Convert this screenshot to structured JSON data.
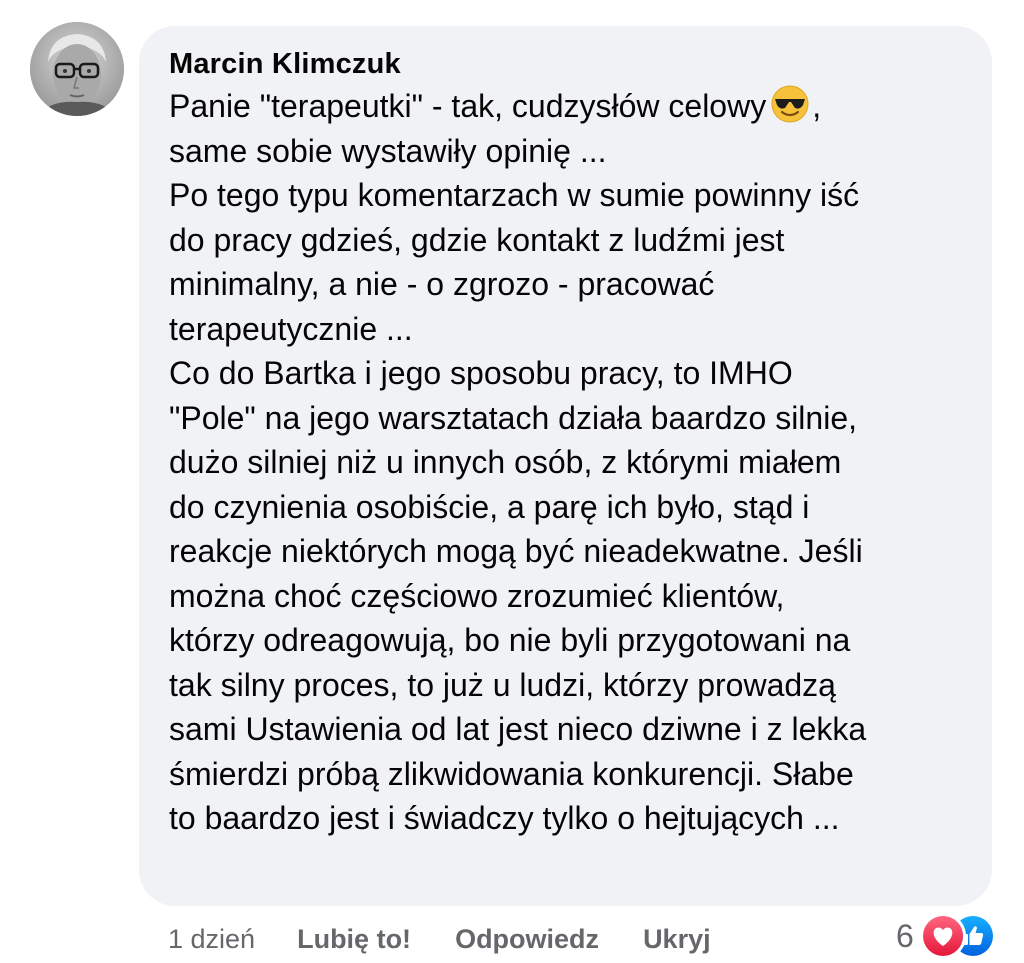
{
  "comment": {
    "author": "Marcin Klimczuk",
    "lines": [
      "Panie \"terapeutki\" - tak, cudzysłów celowy",
      ",",
      "same sobie wystawiły opinię ...",
      "Po tego typu komentarzach w sumie powinny iść",
      "do pracy gdzieś, gdzie kontakt z ludźmi jest",
      "minimalny, a nie - o zgrozo - pracować",
      "terapeutycznie ...",
      "Co do Bartka i jego sposobu pracy, to IMHO",
      "\"Pole\" na jego warsztatach działa baardzo silnie,",
      "dużo silniej niż u innych osób, z którymi miałem",
      "do czynienia osobiście, a parę ich było, stąd i",
      "reakcje niektórych mogą być nieadekwatne. Jeśli",
      "można choć częściowo zrozumieć klientów,",
      "którzy odreagowują, bo nie byli przygotowani na",
      "tak silny proces, to już u ludzi, którzy prowadzą",
      "sami Ustawienia od lat jest nieco dziwne i z lekka",
      "śmierdzi próbą zlikwidowania konkurencji. Słabe",
      "to baardzo jest i świadczy tylko o hejtujących ..."
    ],
    "emoji": "smiling-face-with-sunglasses"
  },
  "actions": {
    "time": "1 dzień",
    "like": "Lubię to!",
    "reply": "Odpowiedz",
    "hide": "Ukryj"
  },
  "reactions": {
    "count": "6",
    "types": [
      "love",
      "like"
    ]
  },
  "colors": {
    "bubble": "#f0f2f5",
    "text": "#050505",
    "secondary": "#65676b",
    "like_blue": "#1877f2",
    "love_red": "#f33e58"
  }
}
